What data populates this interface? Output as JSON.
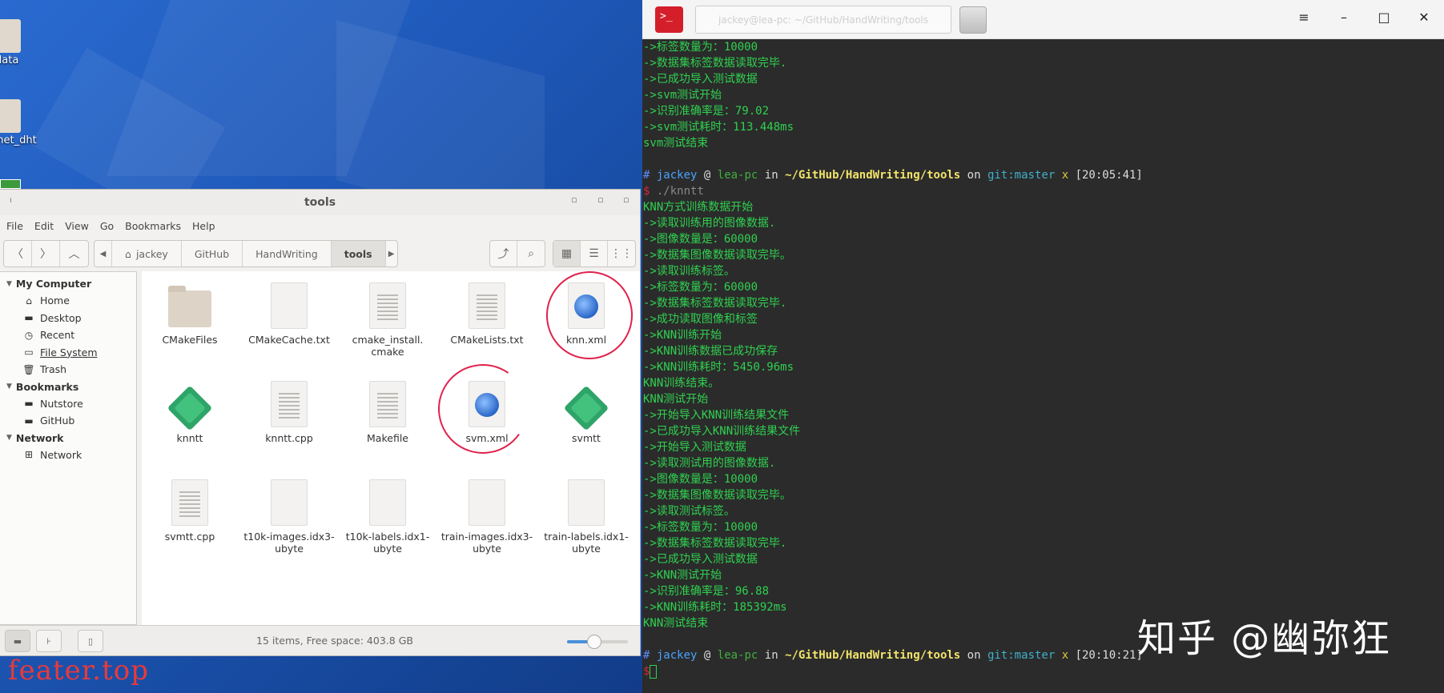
{
  "desktop": {
    "icons": [
      {
        "label": "data"
      },
      {
        "label": "gnet_dht"
      }
    ],
    "watermark": "feater.top"
  },
  "file_manager": {
    "title": "tools",
    "menu": [
      "File",
      "Edit",
      "View",
      "Go",
      "Bookmarks",
      "Help"
    ],
    "breadcrumbs": [
      "jackey",
      "GitHub",
      "HandWriting",
      "tools"
    ],
    "sidebar": {
      "sections": [
        {
          "title": "My Computer",
          "items": [
            {
              "label": "Home",
              "icon": "home-icon"
            },
            {
              "label": "Desktop",
              "icon": "folder-icon"
            },
            {
              "label": "Recent",
              "icon": "clock-icon"
            },
            {
              "label": "File System",
              "icon": "drive-icon"
            },
            {
              "label": "Trash",
              "icon": "trash-icon"
            }
          ]
        },
        {
          "title": "Bookmarks",
          "items": [
            {
              "label": "Nutstore",
              "icon": "folder-icon"
            },
            {
              "label": "GitHub",
              "icon": "folder-icon"
            }
          ]
        },
        {
          "title": "Network",
          "items": [
            {
              "label": "Network",
              "icon": "network-icon"
            }
          ]
        }
      ]
    },
    "files": [
      {
        "name": "CMakeFiles",
        "kind": "folder"
      },
      {
        "name": "CMakeCache.txt",
        "kind": "blank"
      },
      {
        "name": "cmake_install.\ncmake",
        "kind": "text"
      },
      {
        "name": "CMakeLists.txt",
        "kind": "text"
      },
      {
        "name": "knn.xml",
        "kind": "xml"
      },
      {
        "name": "knntt",
        "kind": "exec"
      },
      {
        "name": "knntt.cpp",
        "kind": "text"
      },
      {
        "name": "Makefile",
        "kind": "text"
      },
      {
        "name": "svm.xml",
        "kind": "xml"
      },
      {
        "name": "svmtt",
        "kind": "exec"
      },
      {
        "name": "svmtt.cpp",
        "kind": "text"
      },
      {
        "name": "t10k-images.idx3-\nubyte",
        "kind": "blank"
      },
      {
        "name": "t10k-labels.idx1-\nubyte",
        "kind": "blank"
      },
      {
        "name": "train-images.idx3-\nubyte",
        "kind": "blank"
      },
      {
        "name": "train-labels.idx1-\nubyte",
        "kind": "blank"
      }
    ],
    "status": "15 items, Free space: 403.8 GB",
    "zoom_level": 0.45,
    "annotation_color": "#e0224c"
  },
  "terminal": {
    "tab_title": "jackey@lea-pc: ~/GitHub/HandWriting/tools",
    "accent": "#2fd14f",
    "lines_top": [
      "->标签数量为：10000",
      "->数据集标签数据读取完毕.",
      "->已成功导入测试数据",
      "->svm测试开始",
      "->识别准确率是：79.02",
      "->svm测试耗时：113.448ms",
      "svm测试结束",
      ""
    ],
    "prompt1": {
      "hash": "#",
      "user": "jackey",
      "at": "@",
      "host": "lea-pc",
      "in": "in",
      "path": "~/GitHub/HandWriting/tools",
      "on": "on",
      "git": "git:master",
      "x": "x",
      "time": "[20:05:41]"
    },
    "command1": {
      "dollar": "$",
      "cmd": " ./knntt"
    },
    "lines_knn": [
      "KNN方式训练数据开始",
      "->读取训练用的图像数据.",
      "->图像数量是：60000",
      "->数据集图像数据读取完毕。",
      "->读取训练标签。",
      "->标签数量为：60000",
      "->数据集标签数据读取完毕.",
      "->成功读取图像和标签",
      "->KNN训练开始",
      "->KNN训练数据已成功保存",
      "->KNN训练耗时：5450.96ms",
      "KNN训练结束。",
      "KNN测试开始",
      "->开始导入KNN训练结果文件",
      "->已成功导入KNN训练结果文件",
      "->开始导入测试数据",
      "->读取测试用的图像数据.",
      "->图像数量是：10000",
      "->数据集图像数据读取完毕。",
      "->读取测试标签。",
      "->标签数量为：10000",
      "->数据集标签数据读取完毕.",
      "->已成功导入测试数据",
      "->KNN测试开始",
      "->识别准确率是：96.88",
      "->KNN训练耗时：185392ms",
      "KNN测试结束",
      ""
    ],
    "prompt2": {
      "hash": "#",
      "user": "jackey",
      "at": "@",
      "host": "lea-pc",
      "in": "in",
      "path": "~/GitHub/HandWriting/tools",
      "on": "on",
      "git": "git:master",
      "x": "x",
      "time": "[20:10:21]"
    },
    "command2": {
      "dollar": "$"
    },
    "watermark": "知乎 @幽弥狂"
  }
}
